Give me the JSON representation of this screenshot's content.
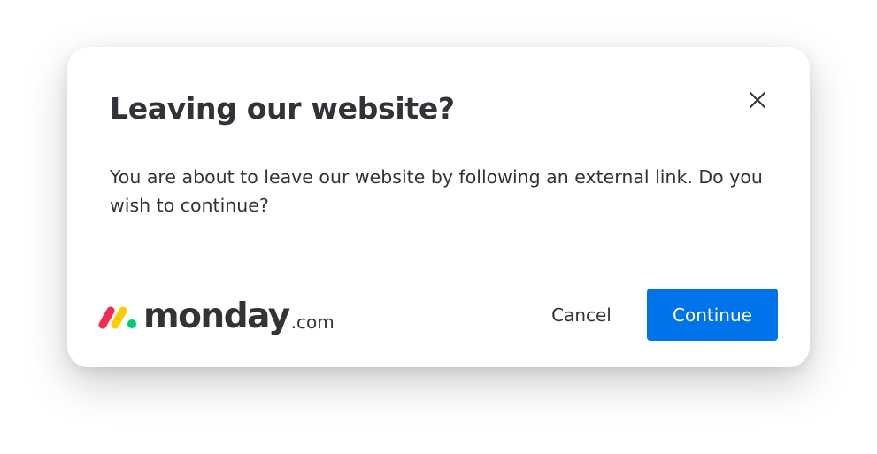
{
  "dialog": {
    "title": "Leaving our website?",
    "message": "You are about to leave our website by following an external link. Do you wish to continue?",
    "close_icon": "close-icon",
    "cancel_label": "Cancel",
    "continue_label": "Continue"
  },
  "brand": {
    "name": "monday",
    "suffix": ".com",
    "mark_colors": [
      "#f62b54",
      "#ffcc00",
      "#00ca72"
    ]
  },
  "colors": {
    "primary": "#0073ea",
    "text": "#323338",
    "background": "#ffffff"
  }
}
